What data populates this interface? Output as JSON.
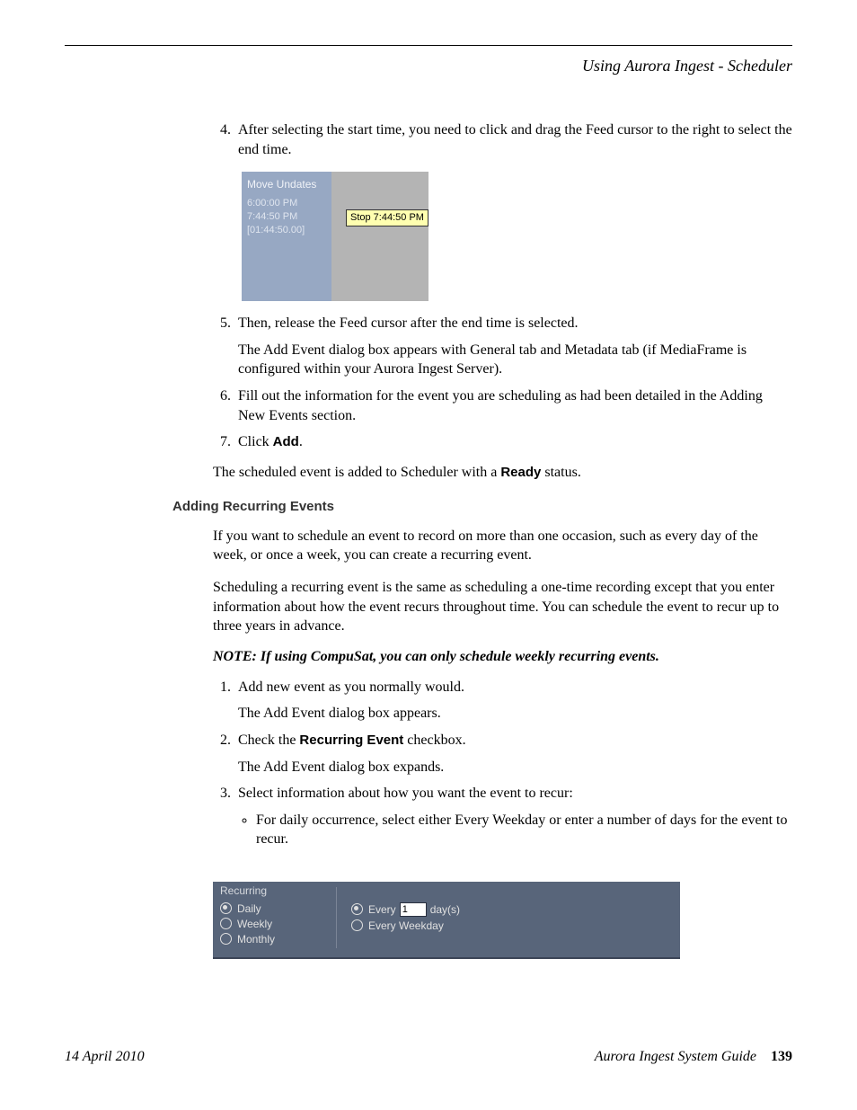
{
  "header": {
    "running_title": "Using Aurora Ingest - Scheduler"
  },
  "steps_a": {
    "s4": "After selecting the start time, you need to click and drag the Feed cursor to the right to select the end time.",
    "s5": "Then, release the Feed cursor after the end time is selected.",
    "s5_detail": "The Add Event dialog box appears with General tab and Metadata tab (if MediaFrame is configured within your Aurora Ingest Server).",
    "s6": "Fill out the information for the event you are scheduling as had been detailed in the Adding New Events section.",
    "s7_prefix": "Click ",
    "s7_bold": "Add",
    "s7_suffix": "."
  },
  "fig1": {
    "title": "Move Undates",
    "line1": "6:00:00 PM",
    "line2": "7:44:50 PM",
    "line3": "[01:44:50.00]",
    "tooltip": "Stop 7:44:50 PM"
  },
  "status": {
    "prefix": "The scheduled event is added to Scheduler with a ",
    "bold": "Ready",
    "suffix": " status."
  },
  "section2": {
    "heading": "Adding Recurring Events",
    "p1": "If you want to schedule an event to record on more than one occasion, such as every day of the week, or once a week, you can create a recurring event.",
    "p2": "Scheduling a recurring event is the same as scheduling a one-time recording except that you enter information about how the event recurs throughout time. You can schedule the event to recur up to three years in advance.",
    "note": "NOTE:  If using CompuSat, you can only schedule weekly recurring events."
  },
  "steps_b": {
    "s1": "Add new event as you normally would.",
    "s1_detail": "The Add Event dialog box appears.",
    "s2_prefix": "Check the ",
    "s2_bold": "Recurring Event",
    "s2_suffix": " checkbox.",
    "s2_detail": "The Add Event dialog box expands.",
    "s3": "Select information about how you want the event to recur:",
    "s3_bullet": "For daily occurrence, select either Every Weekday or enter a number of days for the event to recur."
  },
  "fig2": {
    "legend": "Recurring",
    "daily": "Daily",
    "weekly": "Weekly",
    "monthly": "Monthly",
    "every": "Every",
    "value": "1",
    "days": "day(s)",
    "every_weekday": "Every Weekday"
  },
  "footer": {
    "date": "14 April 2010",
    "guide": "Aurora Ingest System Guide",
    "page": "139"
  }
}
